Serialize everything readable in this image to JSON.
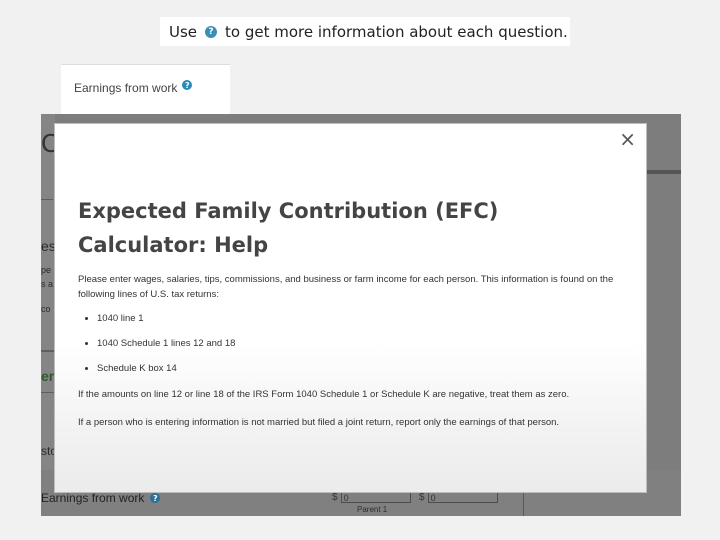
{
  "caption": {
    "prefix": "Use",
    "help_icon": "?",
    "suffix": "to get more information about each question."
  },
  "crop_card": {
    "label": "Earnings from work",
    "help_icon": "?"
  },
  "background": {
    "fragments": [
      "C",
      "es",
      "pe",
      "s a",
      "co",
      "er",
      "sto"
    ],
    "earnings_label": "Earnings from work",
    "currency_1": "$",
    "value_1": "0",
    "currency_2": "$",
    "value_2": "0",
    "parent_label": "Parent 1"
  },
  "modal": {
    "close": "×",
    "title": "Expected Family Contribution (EFC) Calculator: Help",
    "intro": "Please enter wages, salaries, tips, commissions, and business or farm income for each person. This information is found on the following lines of U.S. tax returns:",
    "items": [
      "1040 line 1",
      "1040 Schedule 1 lines 12 and 18",
      "Schedule K box 14"
    ],
    "note_negative": "If the amounts on line 12 or line 18 of the IRS Form 1040 Schedule 1 or Schedule K are negative, treat them as zero.",
    "note_joint": "If a person who is entering information is not married but filed a joint return, report only the earnings of that person."
  },
  "colors": {
    "help_icon": "#3a8fb5",
    "overlay": "#7d7d7d",
    "title_text": "#444444"
  }
}
